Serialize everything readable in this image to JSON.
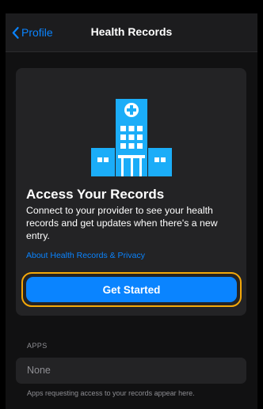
{
  "navbar": {
    "back_label": "Profile",
    "title": "Health Records"
  },
  "card": {
    "icon": "hospital-icon",
    "title": "Access Your Records",
    "description": "Connect to your provider to see your health records and get updates when there's a new entry.",
    "link": "About Health Records & Privacy",
    "button_label": "Get Started"
  },
  "apps": {
    "section_header": "APPS",
    "row_value": "None",
    "footer_note": "Apps requesting access to your records appear here."
  },
  "colors": {
    "accent": "#0a84ff",
    "focus_ring": "#f4a80a",
    "icon_fill": "#1badf8",
    "background": "#1c1c1e",
    "card": "#232325",
    "secondary_text": "#8e8e93"
  }
}
